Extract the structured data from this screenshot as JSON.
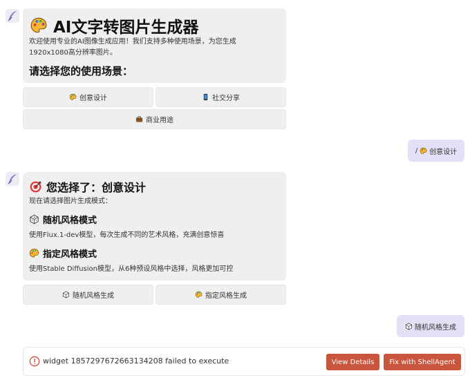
{
  "bot_msg1": {
    "title": "AI文字转图片生成器",
    "title_icon": "palette-icon",
    "desc_line1": "欢迎使用专业的AI图像生成应用！我们支持多种使用场景，为您生成",
    "desc_line2": "1920x1080高分辨率图片。",
    "prompt": "请选择您的使用场景："
  },
  "scene_buttons": [
    {
      "label": "创意设计",
      "icon": "palette-icon"
    },
    {
      "label": "社交分享",
      "icon": "phone-icon"
    },
    {
      "label": "商业用途",
      "icon": "briefcase-icon"
    }
  ],
  "user_msg1": {
    "prefix": "/",
    "label": "创意设计",
    "icon": "palette-icon"
  },
  "bot_msg2": {
    "title": "您选择了：创意设计",
    "title_icon": "target-icon",
    "intro": "现在请选择图片生成模式：",
    "mode1_title": "随机风格模式",
    "mode1_icon": "dice-icon",
    "mode1_desc": "使用Flux.1-dev模型，每次生成不同的艺术风格，充满创意惊喜",
    "mode2_title": "指定风格模式",
    "mode2_icon": "palette-icon",
    "mode2_desc": "使用Stable Diffusion模型，从6种预设风格中选择，风格更加可控"
  },
  "mode_buttons": [
    {
      "label": "随机风格生成",
      "icon": "dice-icon"
    },
    {
      "label": "指定风格生成",
      "icon": "palette-icon"
    }
  ],
  "user_msg2": {
    "label": "随机风格生成",
    "icon": "dice-icon"
  },
  "error": {
    "text": "widget 1857297672663134208 failed to execute",
    "view_label": "View Details",
    "fix_label": "Fix with ShellAgent",
    "icon": "alert-circle-icon"
  },
  "colors": {
    "bot_bubble": "#f0efef",
    "user_bubble": "#e4e0f6",
    "error_button": "#c9553d",
    "error_icon": "#d9463a"
  }
}
